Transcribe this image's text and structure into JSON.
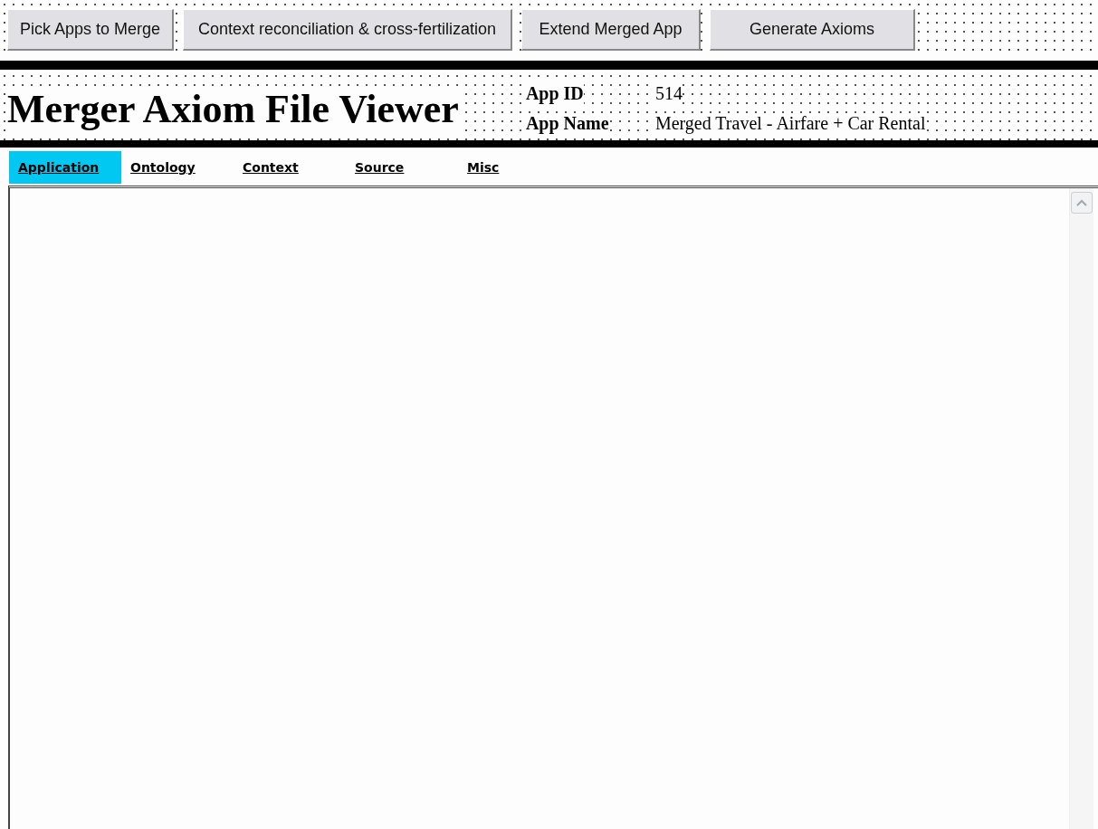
{
  "toolbar": {
    "buttons": [
      {
        "label": "Pick Apps to Merge"
      },
      {
        "label": "Context reconciliation & cross-fertilization"
      },
      {
        "label": "Extend Merged App"
      },
      {
        "label": "Generate Axioms"
      }
    ]
  },
  "header": {
    "title": "Merger Axiom File Viewer",
    "fields": [
      {
        "label": "App ID",
        "value": "514"
      },
      {
        "label": "App Name",
        "value": "Merged Travel - Airfare + Car Rental"
      }
    ]
  },
  "tabs": [
    {
      "label": "Application",
      "selected": true
    },
    {
      "label": "Ontology",
      "selected": false
    },
    {
      "label": "Context",
      "selected": false
    },
    {
      "label": "Source",
      "selected": false
    },
    {
      "label": "Misc",
      "selected": false
    }
  ]
}
